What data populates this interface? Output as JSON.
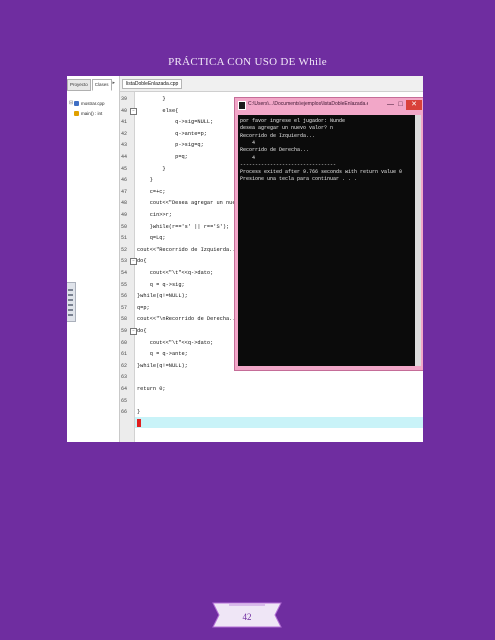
{
  "document": {
    "title": "PRÁCTICA CON USO DE While",
    "page_number": "42"
  },
  "ide": {
    "project_tabs": [
      "Proyecto",
      "Clases"
    ],
    "tree": [
      {
        "label": "mostrar.cpp"
      },
      {
        "label": "main() : int"
      }
    ],
    "editor_tab": "listaDobleEnlazada.cpp",
    "line_numbers": [
      "39",
      "40",
      "41",
      "42",
      "43",
      "44",
      "45",
      "46",
      "47",
      "48",
      "49",
      "50",
      "51",
      "52",
      "53",
      "54",
      "55",
      "56",
      "57",
      "58",
      "59",
      "60",
      "61",
      "62",
      "63",
      "64",
      "65",
      "66"
    ],
    "code_lines": [
      "        }",
      "        else{",
      "            q->sig=NULL;",
      "            q->ante=p;",
      "            p->sig=q;",
      "            p=q;",
      "        }",
      "    }",
      "    c=+c;",
      "    cout<<\"Desea agregar un nuevo valor? \";",
      "    cin>>r;",
      "    }while(r=='s' || r=='S');",
      "    q=Lq;",
      "cout<<\"Recorrido de Izquierda...\\n\";",
      "do{",
      "    cout<<\"\\t\"<<q->dato;",
      "    q = q->sig;",
      "}while(q!=NULL);",
      "q=p;",
      "cout<<\"\\nRecorrido de Derecha...\\n\";",
      "do{",
      "    cout<<\"\\t\"<<q->dato;",
      "    q = q->ante;",
      "}while(q!=NULL);",
      "",
      "return 0;",
      "",
      "}"
    ]
  },
  "console": {
    "title": "C:\\Users\\...\\Documents\\ejemplos\\listaDobleEnlazada.exe",
    "lines": [
      "por favor ingrese el jugador: Nunde",
      "desea agregar un nuevo valor? n",
      "Recorrido de Izquierda...",
      "    4",
      "Recorrido de Derecha...",
      "    4",
      "--------------------------------",
      "Process exited after 9.766 seconds with return value 0",
      "Presione una tecla para continuar . . ."
    ],
    "min_glyph": "—",
    "max_glyph": "□",
    "close_glyph": "✕"
  }
}
